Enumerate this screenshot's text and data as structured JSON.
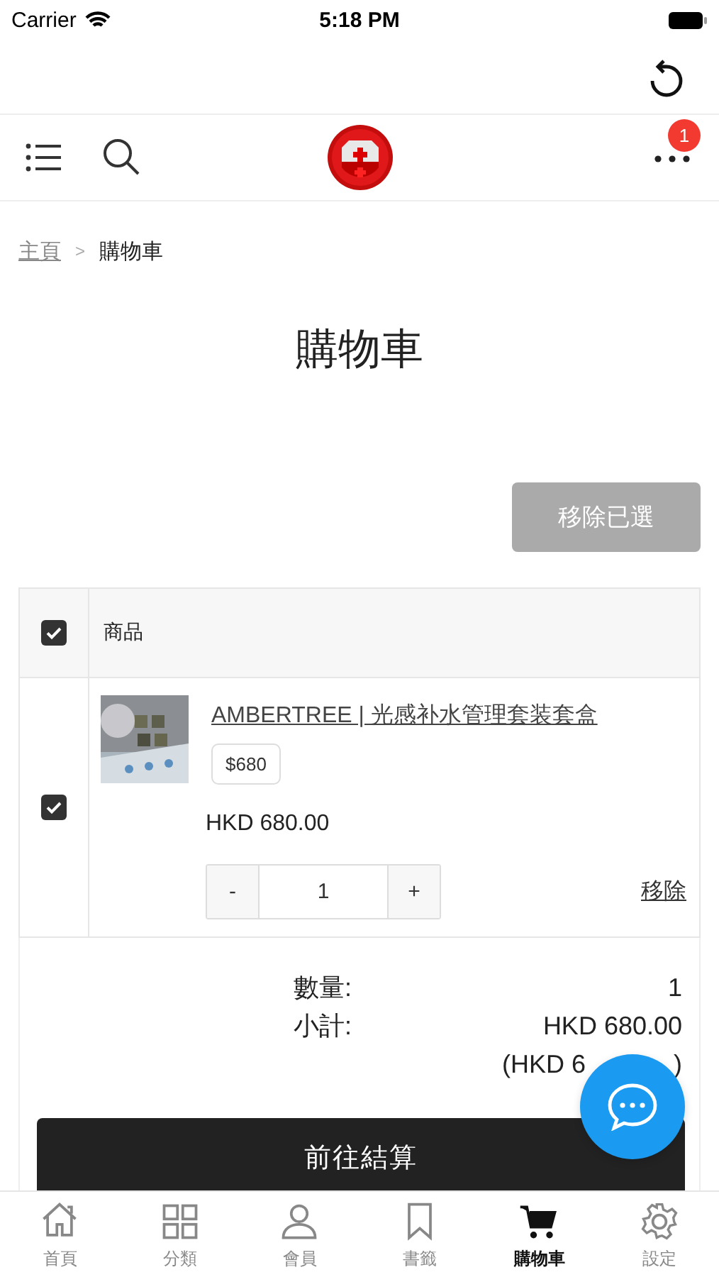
{
  "status_bar": {
    "carrier": "Carrier",
    "time": "5:18 PM"
  },
  "header": {
    "notification_count": "1"
  },
  "breadcrumb": {
    "items": [
      "主頁",
      "購物車"
    ],
    "separator": ">"
  },
  "title": "購物車",
  "remove_selected_button": {
    "label": "移除已選",
    "disabled": true
  },
  "cart_table": {
    "select_all_checked": true,
    "column": "商品",
    "items": [
      {
        "checked": true,
        "name": "AMBERTREE | 光感补水管理套装套盒",
        "option": "$680",
        "price": "HKD 680.00",
        "decrement": "-",
        "quantity": "1",
        "increment": "+",
        "remove": "移除"
      }
    ]
  },
  "summary": [
    {
      "label": "數量:",
      "value": "1"
    },
    {
      "label": "小計:",
      "value": "HKD 680.00"
    }
  ],
  "summary_note": [
    "(HKD 6",
    ")"
  ],
  "checkout_button": "前往結算",
  "tabs": [
    {
      "kind": "home",
      "label": "首頁",
      "selected": false
    },
    {
      "kind": "grid",
      "label": "分類",
      "selected": false
    },
    {
      "kind": "person",
      "label": "會員",
      "selected": false
    },
    {
      "kind": "bookmark",
      "label": "書籤",
      "selected": false
    },
    {
      "kind": "cart",
      "label": "購物車",
      "selected": true
    },
    {
      "kind": "gear",
      "label": "設定",
      "selected": false
    }
  ]
}
